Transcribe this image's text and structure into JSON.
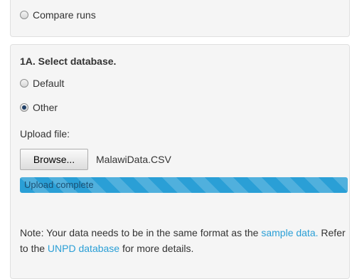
{
  "compare": {
    "label": "Compare runs",
    "checked": false
  },
  "section": {
    "title": "1A. Select database.",
    "options": [
      {
        "label": "Default",
        "checked": false
      },
      {
        "label": "Other",
        "checked": true
      }
    ]
  },
  "upload": {
    "label": "Upload file:",
    "browse_label": "Browse...",
    "file_name": "MalawiData.CSV",
    "progress_text": "Upload complete",
    "progress_percent": 100
  },
  "note": {
    "text_1": "Note: Your data needs to be in the same format as the ",
    "link_1": "sample data.",
    "text_2": " Refer to the ",
    "link_2": "UNPD database",
    "text_3": " for more details."
  },
  "colors": {
    "panel_bg": "#f5f5f5",
    "accent": "#2a9fd6",
    "text": "#333333"
  }
}
